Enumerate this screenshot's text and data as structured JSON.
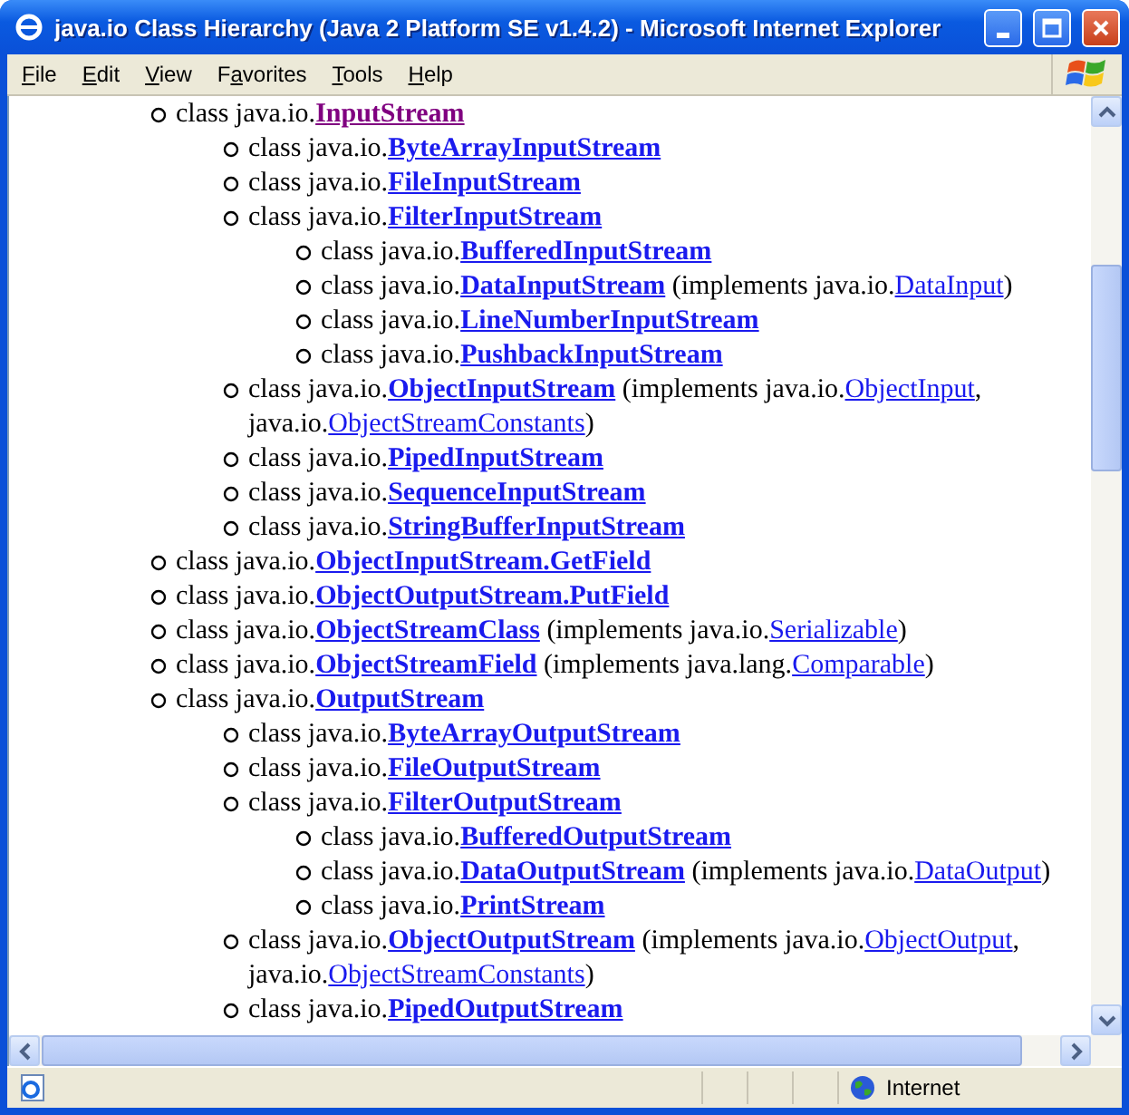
{
  "window": {
    "title": "java.io Class Hierarchy (Java 2 Platform SE v1.4.2) - Microsoft Internet Explorer"
  },
  "menu": [
    {
      "key": "F",
      "after": "ile"
    },
    {
      "key": "E",
      "after": "dit"
    },
    {
      "key": "V",
      "after": "iew"
    },
    {
      "before": "F",
      "key": "a",
      "after": "vorites"
    },
    {
      "key": "T",
      "after": "ools"
    },
    {
      "key": "H",
      "after": "elp"
    }
  ],
  "tree": [
    {
      "lines": [
        [
          {
            "kind": "text",
            "text": "class java.io."
          },
          {
            "kind": "class",
            "text": "InputStream",
            "visited": true
          }
        ]
      ],
      "children": [
        {
          "lines": [
            [
              {
                "kind": "text",
                "text": "class java.io."
              },
              {
                "kind": "class",
                "text": "ByteArrayInputStream",
                "visited": false
              }
            ]
          ]
        },
        {
          "lines": [
            [
              {
                "kind": "text",
                "text": "class java.io."
              },
              {
                "kind": "class",
                "text": "FileInputStream",
                "visited": false
              }
            ]
          ]
        },
        {
          "lines": [
            [
              {
                "kind": "text",
                "text": "class java.io."
              },
              {
                "kind": "class",
                "text": "FilterInputStream",
                "visited": false
              }
            ]
          ],
          "children": [
            {
              "lines": [
                [
                  {
                    "kind": "text",
                    "text": "class java.io."
                  },
                  {
                    "kind": "class",
                    "text": "BufferedInputStream",
                    "visited": false
                  }
                ]
              ]
            },
            {
              "lines": [
                [
                  {
                    "kind": "text",
                    "text": "class java.io."
                  },
                  {
                    "kind": "class",
                    "text": "DataInputStream",
                    "visited": false
                  },
                  {
                    "kind": "text",
                    "text": " (implements java.io."
                  },
                  {
                    "kind": "interface",
                    "text": "DataInput",
                    "visited": false
                  },
                  {
                    "kind": "text",
                    "text": ")"
                  }
                ]
              ]
            },
            {
              "lines": [
                [
                  {
                    "kind": "text",
                    "text": "class java.io."
                  },
                  {
                    "kind": "class",
                    "text": "LineNumberInputStream",
                    "visited": false
                  }
                ]
              ]
            },
            {
              "lines": [
                [
                  {
                    "kind": "text",
                    "text": "class java.io."
                  },
                  {
                    "kind": "class",
                    "text": "PushbackInputStream",
                    "visited": false
                  }
                ]
              ]
            }
          ]
        },
        {
          "lines": [
            [
              {
                "kind": "text",
                "text": "class java.io."
              },
              {
                "kind": "class",
                "text": "ObjectInputStream",
                "visited": false
              },
              {
                "kind": "text",
                "text": " (implements java.io."
              },
              {
                "kind": "interface",
                "text": "ObjectInput",
                "visited": false
              },
              {
                "kind": "text",
                "text": ","
              }
            ],
            [
              {
                "kind": "text",
                "text": "java.io."
              },
              {
                "kind": "interface",
                "text": "ObjectStreamConstants",
                "visited": false
              },
              {
                "kind": "text",
                "text": ")"
              }
            ]
          ]
        },
        {
          "lines": [
            [
              {
                "kind": "text",
                "text": "class java.io."
              },
              {
                "kind": "class",
                "text": "PipedInputStream",
                "visited": false
              }
            ]
          ]
        },
        {
          "lines": [
            [
              {
                "kind": "text",
                "text": "class java.io."
              },
              {
                "kind": "class",
                "text": "SequenceInputStream",
                "visited": false
              }
            ]
          ]
        },
        {
          "lines": [
            [
              {
                "kind": "text",
                "text": "class java.io."
              },
              {
                "kind": "class",
                "text": "StringBufferInputStream",
                "visited": false
              }
            ]
          ]
        }
      ]
    },
    {
      "lines": [
        [
          {
            "kind": "text",
            "text": "class java.io."
          },
          {
            "kind": "class",
            "text": "ObjectInputStream.GetField",
            "visited": false
          }
        ]
      ]
    },
    {
      "lines": [
        [
          {
            "kind": "text",
            "text": "class java.io."
          },
          {
            "kind": "class",
            "text": "ObjectOutputStream.PutField",
            "visited": false
          }
        ]
      ]
    },
    {
      "lines": [
        [
          {
            "kind": "text",
            "text": "class java.io."
          },
          {
            "kind": "class",
            "text": "ObjectStreamClass",
            "visited": false
          },
          {
            "kind": "text",
            "text": " (implements java.io."
          },
          {
            "kind": "interface",
            "text": "Serializable",
            "visited": false
          },
          {
            "kind": "text",
            "text": ")"
          }
        ]
      ]
    },
    {
      "lines": [
        [
          {
            "kind": "text",
            "text": "class java.io."
          },
          {
            "kind": "class",
            "text": "ObjectStreamField",
            "visited": false
          },
          {
            "kind": "text",
            "text": " (implements java.lang."
          },
          {
            "kind": "interface",
            "text": "Comparable",
            "visited": false
          },
          {
            "kind": "text",
            "text": ")"
          }
        ]
      ]
    },
    {
      "lines": [
        [
          {
            "kind": "text",
            "text": "class java.io."
          },
          {
            "kind": "class",
            "text": "OutputStream",
            "visited": false
          }
        ]
      ],
      "children": [
        {
          "lines": [
            [
              {
                "kind": "text",
                "text": "class java.io."
              },
              {
                "kind": "class",
                "text": "ByteArrayOutputStream",
                "visited": false
              }
            ]
          ]
        },
        {
          "lines": [
            [
              {
                "kind": "text",
                "text": "class java.io."
              },
              {
                "kind": "class",
                "text": "FileOutputStream",
                "visited": false
              }
            ]
          ]
        },
        {
          "lines": [
            [
              {
                "kind": "text",
                "text": "class java.io."
              },
              {
                "kind": "class",
                "text": "FilterOutputStream",
                "visited": false
              }
            ]
          ],
          "children": [
            {
              "lines": [
                [
                  {
                    "kind": "text",
                    "text": "class java.io."
                  },
                  {
                    "kind": "class",
                    "text": "BufferedOutputStream",
                    "visited": false
                  }
                ]
              ]
            },
            {
              "lines": [
                [
                  {
                    "kind": "text",
                    "text": "class java.io."
                  },
                  {
                    "kind": "class",
                    "text": "DataOutputStream",
                    "visited": false
                  },
                  {
                    "kind": "text",
                    "text": " (implements java.io."
                  },
                  {
                    "kind": "interface",
                    "text": "DataOutput",
                    "visited": false
                  },
                  {
                    "kind": "text",
                    "text": ")"
                  }
                ]
              ]
            },
            {
              "lines": [
                [
                  {
                    "kind": "text",
                    "text": "class java.io."
                  },
                  {
                    "kind": "class",
                    "text": "PrintStream",
                    "visited": false
                  }
                ]
              ]
            }
          ]
        },
        {
          "lines": [
            [
              {
                "kind": "text",
                "text": "class java.io."
              },
              {
                "kind": "class",
                "text": "ObjectOutputStream",
                "visited": false
              },
              {
                "kind": "text",
                "text": " (implements java.io."
              },
              {
                "kind": "interface",
                "text": "ObjectOutput",
                "visited": false
              },
              {
                "kind": "text",
                "text": ","
              }
            ],
            [
              {
                "kind": "text",
                "text": "java.io."
              },
              {
                "kind": "interface",
                "text": "ObjectStreamConstants",
                "visited": false
              },
              {
                "kind": "text",
                "text": ")"
              }
            ]
          ]
        },
        {
          "lines": [
            [
              {
                "kind": "text",
                "text": "class java.io."
              },
              {
                "kind": "class",
                "text": "PipedOutputStream",
                "visited": false
              }
            ]
          ]
        }
      ]
    }
  ],
  "status_bar": {
    "zone": "Internet"
  }
}
